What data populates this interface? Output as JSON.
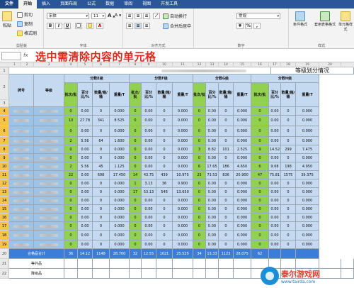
{
  "tabs": [
    "文件",
    "开始",
    "插入",
    "页面布局",
    "公式",
    "数据",
    "审阅",
    "视图",
    "开发工具"
  ],
  "ribbon": {
    "paste_label": "粘贴",
    "cut_label": "剪切",
    "copy_label": "复制",
    "format_painter_label": "格式刷",
    "clipboard_group": "剪贴板",
    "font_name": "宋体",
    "font_size": "11",
    "bold": "B",
    "italic": "I",
    "underline": "U",
    "font_group": "字体",
    "wrap_text_label": "自动换行",
    "merge_center_label": "合并后居中",
    "alignment_group": "对齐方式",
    "number_format": "常规",
    "number_group": "数字",
    "cond_format_label": "条件格式",
    "table_format_label": "套用表格格式",
    "cell_style_label": "单元格样式",
    "style_group": "样式"
  },
  "formula_bar": {
    "fx": "fx",
    "annotation": "选中需清除内容的单元格"
  },
  "columns": [
    "1",
    "2",
    "3",
    "4",
    "5",
    "6",
    "7",
    "8",
    "9",
    "10",
    "11",
    "12",
    "13",
    "14",
    "15",
    "16",
    "17",
    "18",
    "19",
    "20"
  ],
  "sheet": {
    "title": "等级划分情况",
    "col_brand": "牌号",
    "col_grade": "等级",
    "group_e": "分数E级",
    "group_f": "分数F级",
    "group_g": "分数G级",
    "group_h": "分数H级",
    "sub_batch": "批次/批",
    "sub_pct": "百分比/%",
    "sub_qty": "数量/箱/桶",
    "sub_weight": "重量/T",
    "totals_label": "合格品合计",
    "row_out_label": "等外品",
    "row_waste_label": "降级品"
  },
  "row_numbers": [
    "1",
    "2",
    "3",
    "4",
    "5",
    "6",
    "7",
    "8",
    "9",
    "10",
    "11",
    "12",
    "13",
    "14",
    "15",
    "16",
    "17",
    "18",
    "19",
    "20",
    "21",
    "22"
  ],
  "data_rows": [
    [
      "0",
      "0.00",
      "0",
      "0.000",
      "0",
      "0.00",
      "0",
      "0.000",
      "0",
      "0.00",
      "0",
      "0.000",
      "0",
      "0.00",
      "0",
      "0.000"
    ],
    [
      "10",
      "27.78",
      "341",
      "8.525",
      "0",
      "0.00",
      "0",
      "0.000",
      "0",
      "0.00",
      "0",
      "0.000",
      "0",
      "0.00",
      "0",
      "0.000"
    ],
    [
      "0",
      "0.00",
      "0",
      "0.000",
      "0",
      "0.00",
      "0",
      "0.000",
      "0",
      "0.00",
      "0",
      "0.000",
      "0",
      "0.00",
      "0",
      "0.000"
    ],
    [
      "2",
      "5.56",
      "64",
      "1.600",
      "0",
      "0.00",
      "0",
      "0.000",
      "0",
      "0.00",
      "0",
      "0.000",
      "0",
      "0.00",
      "0",
      "0.000"
    ],
    [
      "0",
      "0.00",
      "0",
      "0.000",
      "0",
      "0.00",
      "0",
      "0.000",
      "3",
      "8.82",
      "101",
      "2.525",
      "9",
      "14.52",
      "299",
      "7.475"
    ],
    [
      "0",
      "0.00",
      "0",
      "0.000",
      "0",
      "0.00",
      "0",
      "0.000",
      "0",
      "0.00",
      "0",
      "0.000",
      "0",
      "0.00",
      "0",
      "0.000"
    ],
    [
      "2",
      "5.56",
      "45",
      "1.125",
      "0",
      "0.00",
      "0",
      "0.000",
      "6",
      "17.65",
      "186",
      "4.650",
      "6",
      "9.68",
      "198",
      "4.950"
    ],
    [
      "22",
      "0.00",
      "698",
      "17.450",
      "14",
      "43.75",
      "439",
      "10.975",
      "25",
      "73.53",
      "836",
      "20.900",
      "47",
      "75.81",
      "1575",
      "39.375"
    ],
    [
      "0",
      "0.00",
      "0",
      "0.000",
      "1",
      "3.13",
      "36",
      "0.900",
      "0",
      "0.00",
      "0",
      "0.000",
      "0",
      "0.00",
      "0",
      "0.000"
    ],
    [
      "0",
      "0.00",
      "0",
      "0.000",
      "17",
      "53.13",
      "546",
      "13.650",
      "0",
      "0.00",
      "0",
      "0.000",
      "0",
      "0.00",
      "0",
      "0.000"
    ],
    [
      "0",
      "0.00",
      "0",
      "0.000",
      "0",
      "0.00",
      "0",
      "0.000",
      "0",
      "0.00",
      "0",
      "0.000",
      "0",
      "0.00",
      "0",
      "0.000"
    ],
    [
      "0",
      "0.00",
      "0",
      "0.000",
      "0",
      "0.00",
      "0",
      "0.000",
      "0",
      "0.00",
      "0",
      "0.000",
      "0",
      "0.00",
      "0",
      "0.000"
    ],
    [
      "0",
      "0.00",
      "0",
      "0.000",
      "0",
      "0.00",
      "0",
      "0.000",
      "0",
      "0.00",
      "0",
      "0.000",
      "0",
      "0.00",
      "0",
      "0.000"
    ],
    [
      "0",
      "0.00",
      "0",
      "0.000",
      "0",
      "0.00",
      "0",
      "0.000",
      "0",
      "0.00",
      "0",
      "0.000",
      "0",
      "0.00",
      "0",
      "0.000"
    ],
    [
      "0",
      "0.00",
      "0",
      "0.000",
      "0",
      "0.00",
      "0",
      "0.000",
      "0",
      "0.00",
      "0",
      "0.000",
      "0",
      "0.00",
      "0",
      "0.000"
    ],
    [
      "0",
      "0.00",
      "0",
      "0.000",
      "0",
      "0.00",
      "0",
      "0.000",
      "0",
      "0.00",
      "0",
      "0.000",
      "0",
      "0.00",
      "0",
      "0.000"
    ]
  ],
  "totals_row": [
    "36",
    "14.12",
    "1148",
    "28.700",
    "32",
    "12.55",
    "1021",
    "25.525",
    "34",
    "13.33",
    "1123",
    "28.075",
    "62",
    "",
    "",
    ""
  ],
  "watermark": {
    "name": "泰尔游戏网",
    "url": "www.tairda.com"
  },
  "colors": {
    "accent": "#2b579a",
    "selection": "#9dc3e6",
    "green_col": "#92d050",
    "highlight_blue": "#3b7dd8",
    "annotation": "#e0281c"
  }
}
